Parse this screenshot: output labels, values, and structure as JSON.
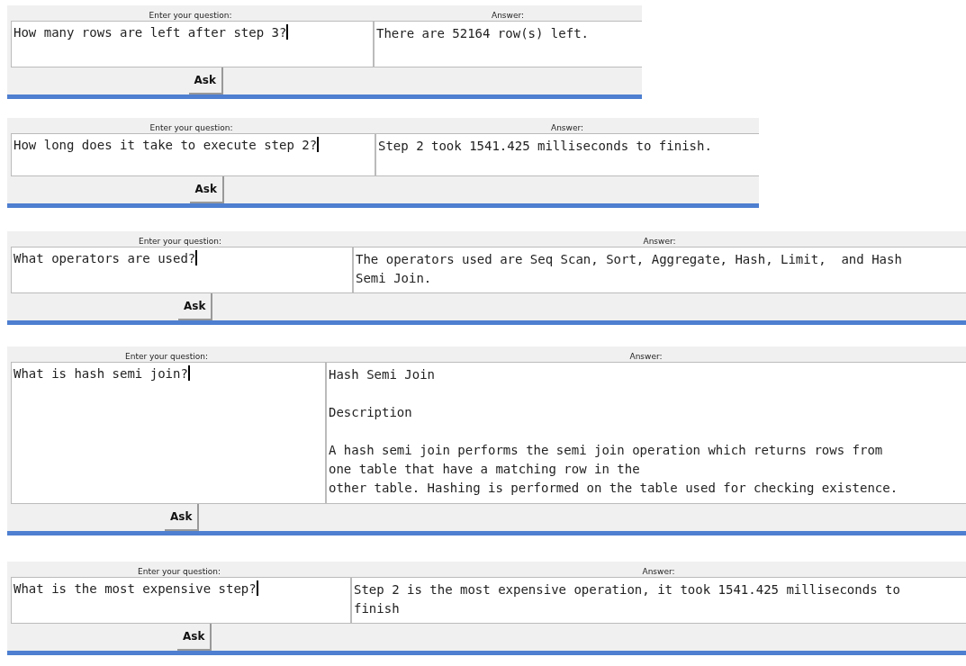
{
  "panels": [
    {
      "question_label": "Enter your question:",
      "question": "How many rows are left after step 3?",
      "answer_label": "Answer:",
      "answer": [
        [
          "There are 52164 row(s) left."
        ]
      ],
      "button": "Ask"
    },
    {
      "question_label": "Enter your question:",
      "question": "How long does it take to execute step 2?",
      "answer_label": "Answer:",
      "answer": [
        [
          "Step 2 took 1541.425 milliseconds to finish."
        ]
      ],
      "button": "Ask"
    },
    {
      "question_label": "Enter your question:",
      "question": "What operators are used?",
      "answer_label": "Answer:",
      "answer": [
        [
          "The operators used are Seq Scan, Sort, Aggregate, Hash, Limit,  and Hash",
          "Semi Join."
        ]
      ],
      "button": "Ask"
    },
    {
      "question_label": "Enter your question:",
      "question": "What is hash semi join?",
      "answer_label": "Answer:",
      "answer": [
        [
          "Hash Semi Join"
        ],
        [
          "Description"
        ],
        [
          "A hash semi join performs the semi join operation which returns rows from",
          "one table that have a matching row in the",
          "other table. Hashing is performed on the table used for checking existence."
        ]
      ],
      "button": "Ask"
    },
    {
      "question_label": "Enter your question:",
      "question": "What is the most expensive step?",
      "answer_label": "Answer:",
      "answer": [
        [
          "Step 2 is the most expensive operation, it took 1541.425 milliseconds to",
          "finish"
        ]
      ],
      "button": "Ask"
    }
  ]
}
